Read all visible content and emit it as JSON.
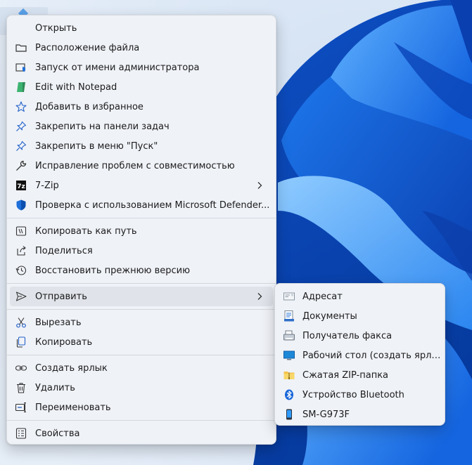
{
  "colors": {
    "accent": "#0067c0",
    "menu_bg": "#eff2f7",
    "hover": "#e0e4ea"
  },
  "menu": {
    "groups": [
      [
        {
          "id": "open",
          "label": "Открыть",
          "icon": "none-icon"
        },
        {
          "id": "file-location",
          "label": "Расположение файла",
          "icon": "folder-icon"
        },
        {
          "id": "run-as-admin",
          "label": "Запуск от имени администратора",
          "icon": "shield-admin-icon"
        },
        {
          "id": "edit-notepad",
          "label": "Edit with Notepad",
          "icon": "notepad-icon"
        },
        {
          "id": "add-favorites",
          "label": "Добавить в избранное",
          "icon": "star-icon"
        },
        {
          "id": "pin-taskbar",
          "label": "Закрепить на панели задач",
          "icon": "pin-icon"
        },
        {
          "id": "pin-start",
          "label": "Закрепить в меню \"Пуск\"",
          "icon": "pin-icon"
        },
        {
          "id": "troubleshoot",
          "label": "Исправление проблем с совместимостью",
          "icon": "wrench-icon"
        },
        {
          "id": "7zip",
          "label": "7-Zip",
          "icon": "7zip-icon",
          "submenu": true
        },
        {
          "id": "defender",
          "label": "Проверка с использованием Microsoft Defender...",
          "icon": "defender-icon"
        }
      ],
      [
        {
          "id": "copy-path",
          "label": "Копировать как путь",
          "icon": "copy-path-icon"
        },
        {
          "id": "share",
          "label": "Поделиться",
          "icon": "share-icon"
        },
        {
          "id": "restore-version",
          "label": "Восстановить прежнюю версию",
          "icon": "history-icon"
        }
      ],
      [
        {
          "id": "send-to",
          "label": "Отправить",
          "icon": "send-icon",
          "submenu": true,
          "highlighted": true
        }
      ],
      [
        {
          "id": "cut",
          "label": "Вырезать",
          "icon": "scissors-icon"
        },
        {
          "id": "copy",
          "label": "Копировать",
          "icon": "copy-icon"
        }
      ],
      [
        {
          "id": "create-shortcut",
          "label": "Создать ярлык",
          "icon": "link-icon"
        },
        {
          "id": "delete",
          "label": "Удалить",
          "icon": "trash-icon"
        },
        {
          "id": "rename",
          "label": "Переименовать",
          "icon": "rename-icon"
        }
      ],
      [
        {
          "id": "properties",
          "label": "Свойства",
          "icon": "properties-icon"
        }
      ]
    ]
  },
  "submenu": {
    "items": [
      {
        "id": "mail-recipient",
        "label": "Адресат",
        "icon": "mail-icon"
      },
      {
        "id": "documents",
        "label": "Документы",
        "icon": "documents-icon"
      },
      {
        "id": "fax-recipient",
        "label": "Получатель факса",
        "icon": "fax-icon"
      },
      {
        "id": "desktop-shortcut",
        "label": "Рабочий стол (создать ярлык)",
        "icon": "desktop-icon"
      },
      {
        "id": "zip-folder",
        "label": "Сжатая ZIP-папка",
        "icon": "zip-folder-icon"
      },
      {
        "id": "bluetooth",
        "label": "Устройство Bluetooth",
        "icon": "bluetooth-icon"
      },
      {
        "id": "phone",
        "label": "SM-G973F",
        "icon": "phone-icon"
      }
    ]
  }
}
